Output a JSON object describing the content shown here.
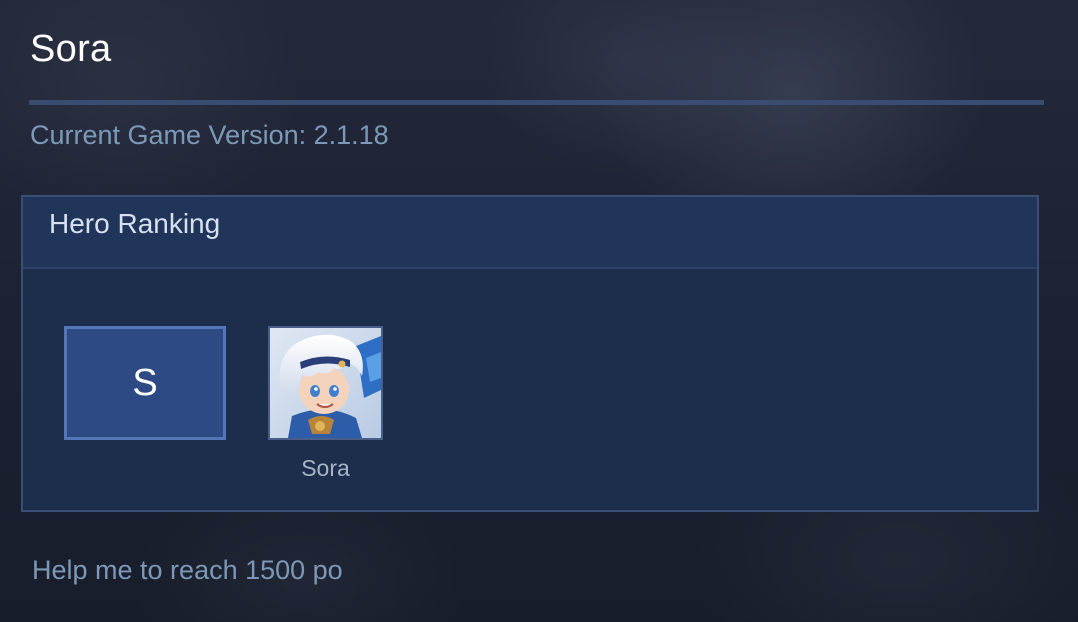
{
  "page": {
    "title": "Sora",
    "version_text": "Current Game Version: 2.1.18"
  },
  "ranking": {
    "header": "Hero Ranking",
    "tier": "S",
    "heroes": [
      {
        "name": "Sora",
        "icon": "hero-portrait-icon"
      }
    ]
  },
  "footer": {
    "note": "Help me to reach 1500 po"
  },
  "colors": {
    "background": "#1c2233",
    "panel": "#1d2d4c",
    "panel_header": "#213459",
    "tier_box": "#2d4a84",
    "accent_text": "#7c9ab8"
  }
}
